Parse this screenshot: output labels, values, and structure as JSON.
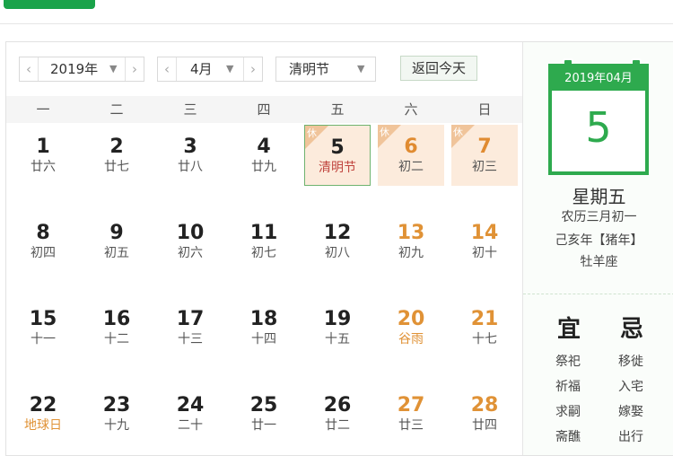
{
  "toolbar": {
    "year_label": "2019年",
    "month_label": "4月",
    "holiday_label": "清明节",
    "today_label": "返回今天"
  },
  "weekdays": [
    "一",
    "二",
    "三",
    "四",
    "五",
    "六",
    "日"
  ],
  "weeks": [
    [
      {
        "d": "1",
        "l": "廿六"
      },
      {
        "d": "2",
        "l": "廿七"
      },
      {
        "d": "3",
        "l": "廿八"
      },
      {
        "d": "4",
        "l": "廿九"
      },
      {
        "d": "5",
        "l": "清明节",
        "badge": "休"
      },
      {
        "d": "6",
        "l": "初二",
        "badge": "休"
      },
      {
        "d": "7",
        "l": "初三",
        "badge": "休"
      }
    ],
    [
      {
        "d": "8",
        "l": "初四"
      },
      {
        "d": "9",
        "l": "初五"
      },
      {
        "d": "10",
        "l": "初六"
      },
      {
        "d": "11",
        "l": "初七"
      },
      {
        "d": "12",
        "l": "初八"
      },
      {
        "d": "13",
        "l": "初九"
      },
      {
        "d": "14",
        "l": "初十"
      }
    ],
    [
      {
        "d": "15",
        "l": "十一"
      },
      {
        "d": "16",
        "l": "十二"
      },
      {
        "d": "17",
        "l": "十三"
      },
      {
        "d": "18",
        "l": "十四"
      },
      {
        "d": "19",
        "l": "十五"
      },
      {
        "d": "20",
        "l": "谷雨"
      },
      {
        "d": "21",
        "l": "十七"
      }
    ],
    [
      {
        "d": "22",
        "l": "地球日"
      },
      {
        "d": "23",
        "l": "十九"
      },
      {
        "d": "24",
        "l": "二十"
      },
      {
        "d": "25",
        "l": "廿一"
      },
      {
        "d": "26",
        "l": "廿二"
      },
      {
        "d": "27",
        "l": "廿三"
      },
      {
        "d": "28",
        "l": "廿四"
      }
    ]
  ],
  "side": {
    "card_header": "2019年04月",
    "card_day": "5",
    "weekday": "星期五",
    "lunar": "农历三月初一",
    "ganzhi": "己亥年【猪年】",
    "constellation": "牡羊座",
    "yi_label": "宜",
    "ji_label": "忌",
    "yi_items": [
      "祭祀",
      "祈福",
      "求嗣",
      "斋醮"
    ],
    "ji_items": [
      "移徙",
      "入宅",
      "嫁娶",
      "出行"
    ]
  }
}
